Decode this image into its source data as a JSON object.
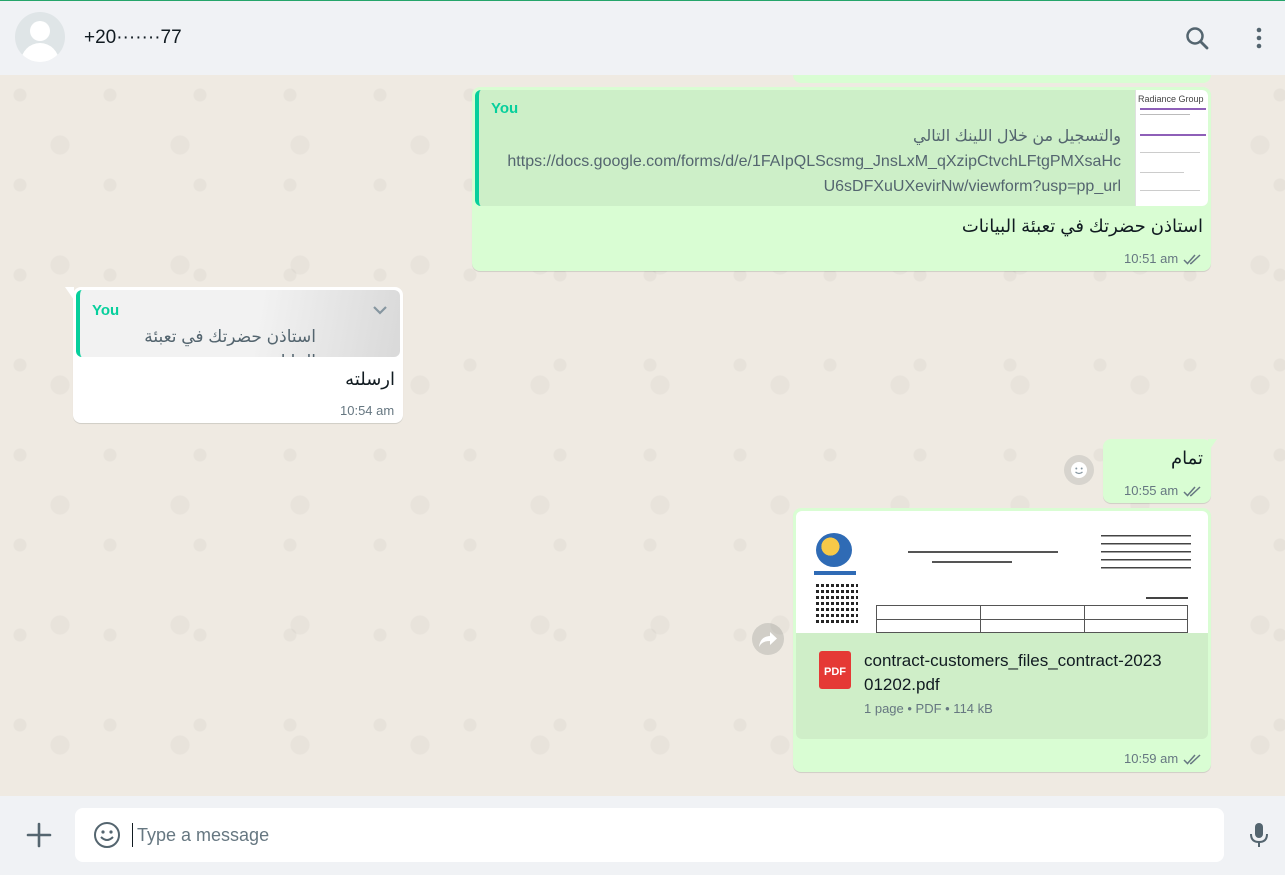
{
  "header": {
    "contact_name": "+20·······77",
    "search_icon": "search-icon",
    "menu_icon": "menu-icon"
  },
  "messages": [
    {
      "direction": "out",
      "quote": {
        "author": "You",
        "line1": "والتسجيل من خلال اللينك التالي",
        "line2": "https://docs.google.com/forms/d/e/1FAIpQLScsmg_JnsLxM_qXzipCtvchLFtgPMXsaHc",
        "line3": "U6sDFXuUXevirNw/viewform?usp=pp_url",
        "thumb_title": "Radiance Group"
      },
      "text": "استاذن حضرتك في تعبئة البيانات",
      "time": "10:51 am"
    },
    {
      "direction": "in",
      "quote": {
        "author": "You",
        "line1": "استاذن حضرتك في تعبئة البيانات"
      },
      "text": "ارسلته",
      "time": "10:54 am"
    },
    {
      "direction": "out",
      "text": "تمام",
      "time": "10:55 am"
    },
    {
      "direction": "out",
      "document": {
        "filename": "contract-customers_files_contract-202301202.pdf",
        "filename_line1": "contract-customers_files_contract-2023",
        "filename_line2": "01202.pdf",
        "icon_label": "PDF",
        "meta": "1 page • PDF • 114 kB"
      },
      "time": "10:59 am"
    }
  ],
  "composer": {
    "placeholder": "Type a message",
    "value": ""
  },
  "colors": {
    "outgoing_bubble": "#d9fdd3",
    "incoming_bubble": "#ffffff",
    "accent": "#06cf9c",
    "read_ticks": "#667781"
  }
}
